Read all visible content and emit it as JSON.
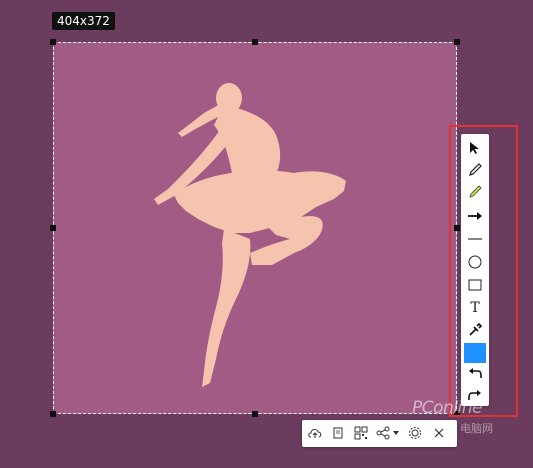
{
  "capture": {
    "dimensions_label": "404x372"
  },
  "colors": {
    "selection_fill": "#a15b85",
    "dancer_fill": "#f6c3af",
    "highlight_frame": "#e23131",
    "current_color": "#1e90ff"
  },
  "tool_panel": {
    "tools": [
      {
        "name": "select-arrow-icon"
      },
      {
        "name": "pencil-icon"
      },
      {
        "name": "highlighter-icon"
      },
      {
        "name": "arrow-icon"
      },
      {
        "name": "line-icon"
      },
      {
        "name": "circle-icon"
      },
      {
        "name": "rectangle-icon"
      },
      {
        "name": "text-icon",
        "label": "T"
      },
      {
        "name": "eyedropper-icon"
      },
      {
        "name": "color-swatch"
      },
      {
        "name": "undo-icon"
      },
      {
        "name": "redo-icon"
      }
    ]
  },
  "bottom_toolbar": {
    "buttons": [
      {
        "name": "cloud-upload-icon"
      },
      {
        "name": "copy-icon"
      },
      {
        "name": "qr-code-icon"
      },
      {
        "name": "share-icon"
      },
      {
        "name": "chevron-down-icon"
      },
      {
        "name": "settings-icon"
      },
      {
        "name": "close-icon"
      }
    ]
  },
  "watermark": {
    "brand": "PConline",
    "subtitle": "电脑网"
  }
}
